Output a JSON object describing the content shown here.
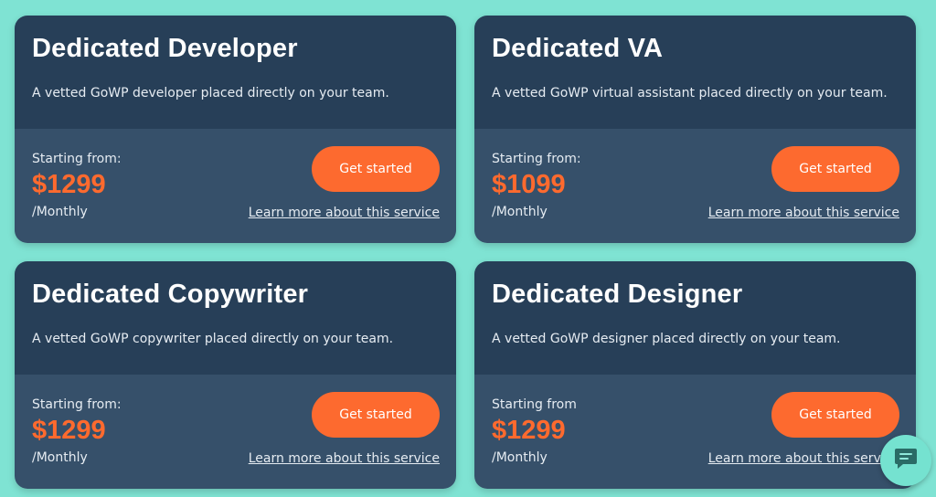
{
  "colors": {
    "background": "#7fe3d3",
    "card_top": "#273f58",
    "card_bottom": "#36506a",
    "accent": "#fd6a2f"
  },
  "cards": [
    {
      "title": "Dedicated Developer",
      "description": "A vetted GoWP developer placed directly on your team.",
      "starting_label": "Starting from:",
      "price": "$1299",
      "period": "/Monthly",
      "button": "Get started",
      "learn_more": "Learn more about this service"
    },
    {
      "title": "Dedicated VA",
      "description": "A vetted GoWP virtual assistant placed directly on your team.",
      "starting_label": "Starting from:",
      "price": "$1099",
      "period": "/Monthly",
      "button": "Get started",
      "learn_more": "Learn more about this service"
    },
    {
      "title": "Dedicated Copywriter",
      "description": "A vetted GoWP copywriter placed directly on your team.",
      "starting_label": "Starting from:",
      "price": "$1299",
      "period": "/Monthly",
      "button": "Get started",
      "learn_more": "Learn more about this service"
    },
    {
      "title": "Dedicated Designer",
      "description": "A vetted GoWP designer placed directly on your team.",
      "starting_label": "Starting from",
      "price": "$1299",
      "period": "/Monthly",
      "button": "Get started",
      "learn_more": "Learn more about this service"
    }
  ],
  "chat_widget": {
    "icon": "chat-bubble-icon"
  }
}
